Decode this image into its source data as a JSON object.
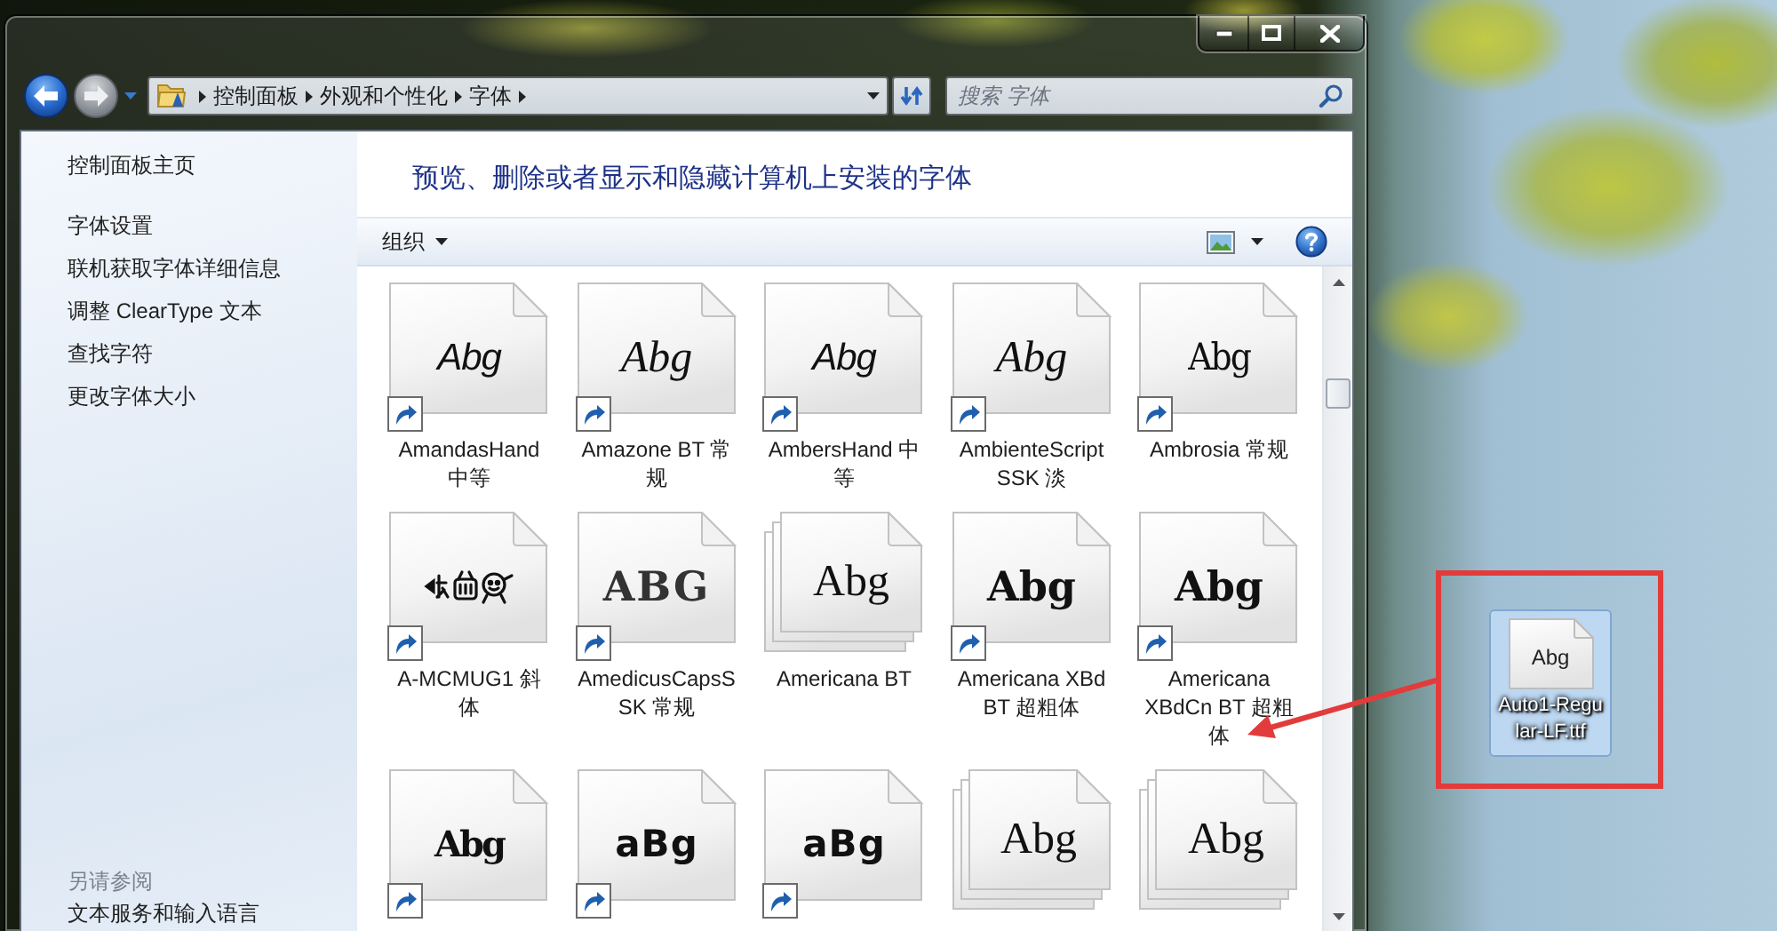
{
  "window": {
    "address_bar": {
      "path": [
        "控制面板",
        "外观和个性化",
        "字体"
      ]
    },
    "search": {
      "placeholder": "搜索 字体"
    }
  },
  "sidebar": {
    "home": "控制面板主页",
    "tasks": [
      "字体设置",
      "联机获取字体详细信息",
      "调整 ClearType 文本",
      "查找字符",
      "更改字体大小"
    ],
    "see_also": {
      "title": "另请参阅",
      "items": [
        "文本服务和输入语言"
      ]
    }
  },
  "content": {
    "heading": "预览、删除或者显示和隐藏计算机上安装的字体",
    "toolbar": {
      "organize": "组织"
    }
  },
  "fonts": [
    {
      "name": "AmandasHand 中等",
      "kind": "shortcut",
      "sample": {
        "kind": "handwriting",
        "text": "Abg"
      }
    },
    {
      "name": "Amazone BT 常规",
      "kind": "shortcut",
      "sample": {
        "kind": "script",
        "text": "Abg"
      }
    },
    {
      "name": "AmbersHand 中等",
      "kind": "shortcut",
      "sample": {
        "kind": "handwriting",
        "text": "Abg"
      }
    },
    {
      "name": "AmbienteScript SSK 淡",
      "kind": "shortcut",
      "sample": {
        "kind": "script",
        "text": "Abg"
      }
    },
    {
      "name": "Ambrosia 常规",
      "kind": "shortcut",
      "sample": {
        "kind": "narrow",
        "text": "Abg"
      }
    },
    {
      "name": "A-MCMUG1 斜体",
      "kind": "shortcut",
      "sample": {
        "kind": "dingbat"
      }
    },
    {
      "name": "AmedicusCapsSSK 常规",
      "kind": "shortcut",
      "sample": {
        "kind": "caps",
        "text": "ABG"
      }
    },
    {
      "name": "Americana BT",
      "kind": "family",
      "sample": {
        "kind": "serif",
        "text": "Abg"
      }
    },
    {
      "name": "Americana XBd BT 超粗体",
      "kind": "shortcut",
      "sample": {
        "kind": "bold",
        "text": "Abg"
      }
    },
    {
      "name": "Americana XBdCn BT 超粗体",
      "kind": "shortcut",
      "sample": {
        "kind": "bold",
        "text": "Abg"
      }
    },
    {
      "kind": "shortcut",
      "sample": {
        "kind": "blackletter",
        "text": "Abg"
      }
    },
    {
      "kind": "shortcut",
      "sample": {
        "kind": "uncial",
        "text": "aBg"
      }
    },
    {
      "kind": "shortcut",
      "sample": {
        "kind": "uncial",
        "text": "aBg"
      }
    },
    {
      "kind": "family",
      "sample": {
        "kind": "serif",
        "text": "Abg"
      }
    },
    {
      "kind": "family",
      "sample": {
        "kind": "serif",
        "text": "Abg"
      }
    }
  ],
  "desktop_file": {
    "name": "Auto1-Regular-LF.ttf",
    "sample": "Abg",
    "selected": true
  }
}
